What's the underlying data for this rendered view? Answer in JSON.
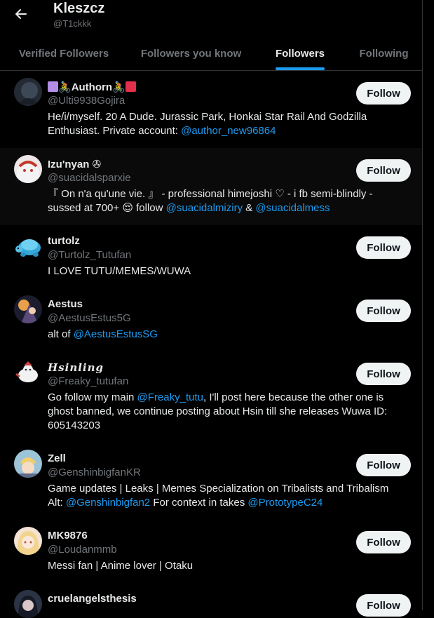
{
  "header": {
    "title": "Kleszcz",
    "handle": "@T1ckkk"
  },
  "tabs": [
    {
      "label": "Verified Followers"
    },
    {
      "label": "Followers you know"
    },
    {
      "label": "Followers"
    },
    {
      "label": "Following"
    }
  ],
  "active_tab": "Followers",
  "follow_label": "Follow",
  "colors": {
    "background": "#000000",
    "accent": "#1d9bf0",
    "muted": "#71767b",
    "button_bg": "#eff3f4"
  },
  "users": [
    {
      "name_left_emoji": "purple-square",
      "name": "Authorn",
      "name_right_emoji": "red-square",
      "handle": "@Ulti9938Gojira",
      "bio_1": "He/i/myself. 20 A Dude. Jurassic Park, Honkai Star Rail And Godzilla",
      "bio_2a": "Enthusiast. Private account: ",
      "bio_2b": "@author_new96864"
    },
    {
      "name": "Izu'nyan",
      "name_badge": "✇",
      "handle": "@suacidalsparxie",
      "bio_1": "『 On n'a qu'une vie. 』 - professional himejoshi ♡ - i fb semi-blindly -",
      "bio_2a": "sussed at 700+ 😌 follow ",
      "bio_2b": "@suacidalmiziry",
      "bio_2c": " & ",
      "bio_2d": "@suacidalmess"
    },
    {
      "name": "turtolz",
      "handle": "@Turtolz_Tutufan",
      "bio_1": "I LOVE TUTU/MEMES/WUWA"
    },
    {
      "name": "Aestus",
      "handle": "@AestusEstus5G",
      "bio_1a": "alt of ",
      "bio_1b": "@AestusEstusSG"
    },
    {
      "name": "Hsinling",
      "handle": "@Freaky_tutufan",
      "bio_1a": "Go follow my main ",
      "bio_1b": "@Freaky_tutu",
      "bio_1c": ", I'll post here because the other one is",
      "bio_2": "ghost banned, we continue posting about Hsin till she releases Wuwa ID:",
      "bio_3": "605143203"
    },
    {
      "name": "Zell",
      "handle": "@GenshinbigfanKR",
      "bio_1": "Game updates | Leaks | Memes Specialization on Tribalists and Tribalism",
      "bio_2a": "Alt: ",
      "bio_2b": "@Genshinbigfan2",
      "bio_2c": " For context in takes ",
      "bio_2d": "@PrototypeC24"
    },
    {
      "name": "MK9876",
      "handle": "@Loudanmmb",
      "bio_1": "Messi fan | Anime lover | Otaku"
    },
    {
      "name": "cruelangelsthesis",
      "handle": ""
    }
  ]
}
